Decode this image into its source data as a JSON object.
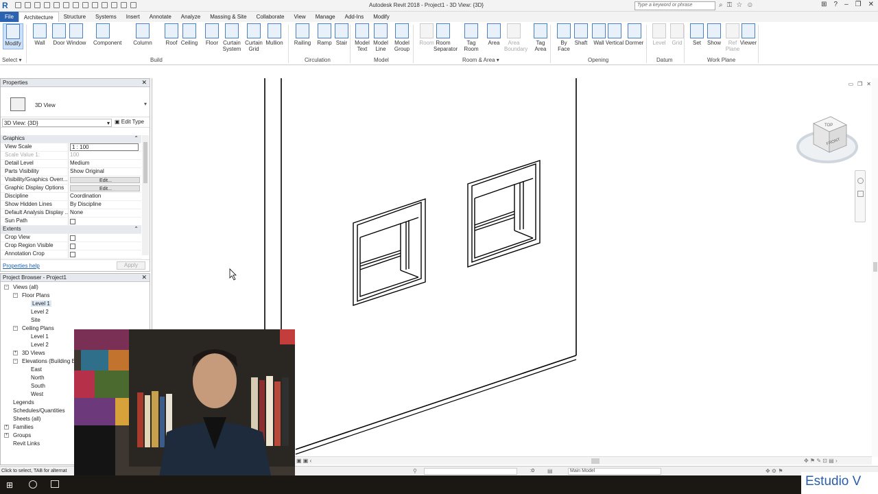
{
  "titlebar": {
    "app_title": "Autodesk Revit 2018 -    Project1 - 3D View: {3D}",
    "search_placeholder": "Type a keyword or phrase"
  },
  "tabs": [
    "File",
    "Architecture",
    "Structure",
    "Systems",
    "Insert",
    "Annotate",
    "Analyze",
    "Massing & Site",
    "Collaborate",
    "View",
    "Manage",
    "Add-Ins",
    "Modify"
  ],
  "ribbon": {
    "select_label": "Select",
    "tools": [
      {
        "label": "Modify",
        "l2": ""
      },
      {
        "label": "Wall",
        "l2": ""
      },
      {
        "label": "Door",
        "l2": ""
      },
      {
        "label": "Window",
        "l2": ""
      },
      {
        "label": "Component",
        "l2": ""
      },
      {
        "label": "Column",
        "l2": ""
      },
      {
        "label": "Roof",
        "l2": ""
      },
      {
        "label": "Ceiling",
        "l2": ""
      },
      {
        "label": "Floor",
        "l2": ""
      },
      {
        "label": "Curtain",
        "l2": "System"
      },
      {
        "label": "Curtain",
        "l2": "Grid"
      },
      {
        "label": "Mullion",
        "l2": ""
      },
      {
        "label": "Railing",
        "l2": ""
      },
      {
        "label": "Ramp",
        "l2": ""
      },
      {
        "label": "Stair",
        "l2": ""
      },
      {
        "label": "Model",
        "l2": "Text"
      },
      {
        "label": "Model",
        "l2": "Line"
      },
      {
        "label": "Model",
        "l2": "Group"
      },
      {
        "label": "Room",
        "l2": ""
      },
      {
        "label": "Room",
        "l2": "Separator"
      },
      {
        "label": "Tag",
        "l2": "Room"
      },
      {
        "label": "Area",
        "l2": ""
      },
      {
        "label": "Area",
        "l2": "Boundary"
      },
      {
        "label": "Tag",
        "l2": "Area"
      },
      {
        "label": "By",
        "l2": "Face"
      },
      {
        "label": "Shaft",
        "l2": ""
      },
      {
        "label": "Wall",
        "l2": ""
      },
      {
        "label": "Vertical",
        "l2": ""
      },
      {
        "label": "Dormer",
        "l2": ""
      },
      {
        "label": "Level",
        "l2": ""
      },
      {
        "label": "Grid",
        "l2": ""
      },
      {
        "label": "Set",
        "l2": ""
      },
      {
        "label": "Show",
        "l2": ""
      },
      {
        "label": "Ref",
        "l2": "Plane"
      },
      {
        "label": "Viewer",
        "l2": ""
      }
    ],
    "groups": [
      "Build",
      "Circulation",
      "Model",
      "Room & Area",
      "Opening",
      "Datum",
      "Work Plane"
    ]
  },
  "properties": {
    "title": "Properties",
    "type_name": "3D View",
    "instance_selector": "3D View: {3D}",
    "edit_type": "Edit Type",
    "rows": [
      {
        "k": "Graphics",
        "v": "",
        "section": true
      },
      {
        "k": "View Scale",
        "v": "1 : 100"
      },
      {
        "k": "Scale Value    1:",
        "v": "100"
      },
      {
        "k": "Detail Level",
        "v": "Medium"
      },
      {
        "k": "Parts Visibility",
        "v": "Show Original"
      },
      {
        "k": "Visibility/Graphics Overr...",
        "v": "Edit..."
      },
      {
        "k": "Graphic Display Options",
        "v": "Edit..."
      },
      {
        "k": "Discipline",
        "v": "Coordination"
      },
      {
        "k": "Show Hidden Lines",
        "v": "By Discipline"
      },
      {
        "k": "Default Analysis Display ...",
        "v": "None"
      },
      {
        "k": "Sun Path",
        "v": ""
      },
      {
        "k": "Extents",
        "v": "",
        "section": true
      },
      {
        "k": "Crop View",
        "v": ""
      },
      {
        "k": "Crop Region Visible",
        "v": ""
      },
      {
        "k": "Annotation Crop",
        "v": ""
      }
    ],
    "help_link": "Properties help",
    "apply": "Apply"
  },
  "browser": {
    "title": "Project Browser - Project1",
    "nodes": [
      {
        "label": "Views (all)",
        "level": 0
      },
      {
        "label": "Floor Plans",
        "level": 1
      },
      {
        "label": "Level 1",
        "level": 2
      },
      {
        "label": "Level 2",
        "level": 2
      },
      {
        "label": "Site",
        "level": 2
      },
      {
        "label": "Ceiling Plans",
        "level": 1
      },
      {
        "label": "Level 1",
        "level": 2
      },
      {
        "label": "Level 2",
        "level": 2
      },
      {
        "label": "3D Views",
        "level": 1
      },
      {
        "label": "Elevations (Building El",
        "level": 1
      },
      {
        "label": "East",
        "level": 2
      },
      {
        "label": "North",
        "level": 2
      },
      {
        "label": "South",
        "level": 2
      },
      {
        "label": "West",
        "level": 2
      },
      {
        "label": "Legends",
        "level": 0
      },
      {
        "label": "Schedules/Quantities",
        "level": 0
      },
      {
        "label": "Sheets (all)",
        "level": 0
      },
      {
        "label": "Families",
        "level": 0
      },
      {
        "label": "Groups",
        "level": 0
      },
      {
        "label": "Revit Links",
        "level": 0
      }
    ]
  },
  "viewcube": {
    "top": "TOP",
    "front": "FRONT"
  },
  "status": {
    "hint": "Click to select, TAB for alternat",
    "zero": ":0",
    "model": "Main Model"
  },
  "watermark": "Estudio V"
}
